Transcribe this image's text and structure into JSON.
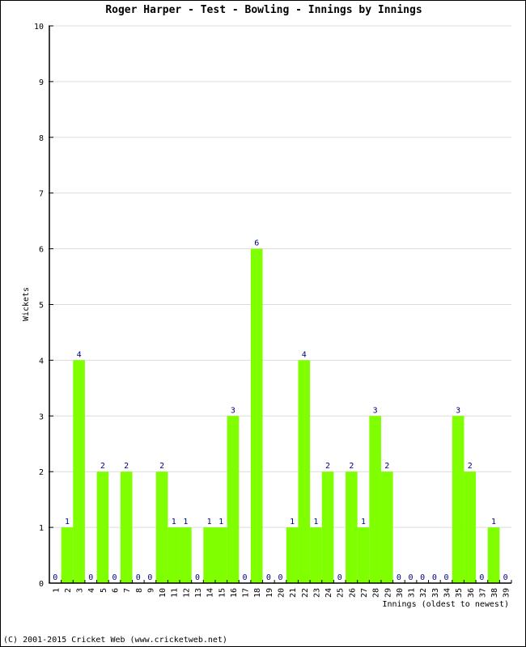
{
  "chart_data": {
    "type": "bar",
    "title": "Roger Harper - Test - Bowling - Innings by Innings",
    "xlabel": "Innings (oldest to newest)",
    "ylabel": "Wickets",
    "ylim": [
      0,
      10
    ],
    "yticks": [
      0,
      1,
      2,
      3,
      4,
      5,
      6,
      7,
      8,
      9,
      10
    ],
    "grid": true,
    "categories": [
      "1",
      "2",
      "3",
      "4",
      "5",
      "6",
      "7",
      "8",
      "9",
      "10",
      "11",
      "12",
      "13",
      "14",
      "15",
      "16",
      "17",
      "18",
      "19",
      "20",
      "21",
      "22",
      "23",
      "24",
      "25",
      "26",
      "27",
      "28",
      "29",
      "30",
      "31",
      "32",
      "33",
      "34",
      "35",
      "36",
      "37",
      "38",
      "39"
    ],
    "values": [
      0,
      1,
      4,
      0,
      2,
      0,
      2,
      0,
      0,
      2,
      1,
      1,
      0,
      1,
      1,
      3,
      0,
      6,
      0,
      0,
      1,
      4,
      1,
      2,
      0,
      2,
      1,
      3,
      2,
      0,
      0,
      0,
      0,
      0,
      3,
      2,
      0,
      1,
      0
    ],
    "bar_color": "#80ff00",
    "label_color": "#000080"
  },
  "footer": "(C) 2001-2015 Cricket Web (www.cricketweb.net)"
}
